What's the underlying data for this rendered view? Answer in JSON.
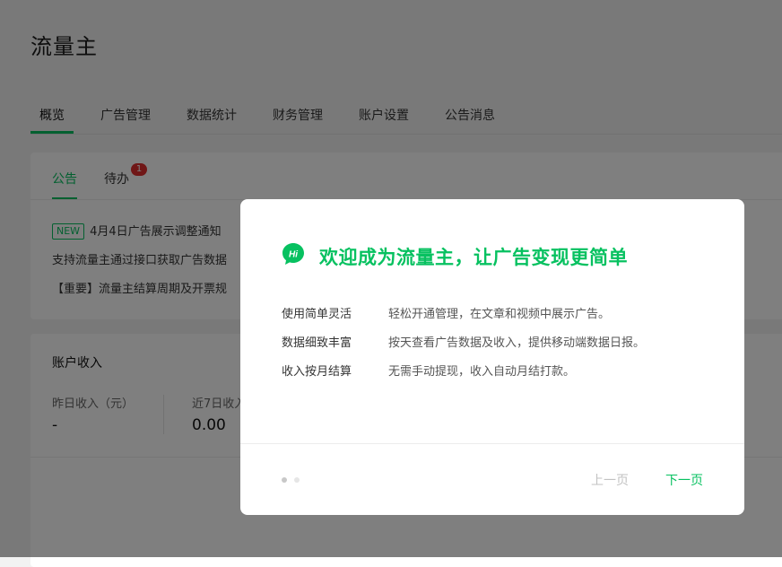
{
  "app": {
    "title": "流量主"
  },
  "main_tabs": [
    {
      "label": "概览"
    },
    {
      "label": "广告管理"
    },
    {
      "label": "数据统计"
    },
    {
      "label": "财务管理"
    },
    {
      "label": "账户设置"
    },
    {
      "label": "公告消息"
    }
  ],
  "notice_card": {
    "tabs": [
      {
        "label": "公告"
      },
      {
        "label": "待办"
      }
    ],
    "todo_badge": "1",
    "new_tag": "NEW",
    "items": [
      "4月4日广告展示调整通知",
      "支持流量主通过接口获取广告数据",
      "【重要】流量主结算周期及开票规"
    ]
  },
  "income_card": {
    "title": "账户收入",
    "stats": [
      {
        "label": "昨日收入（元）",
        "value": "-"
      },
      {
        "label": "近7日收入",
        "value": "0.00"
      }
    ]
  },
  "modal": {
    "icon": "hi-chat-bubble-icon",
    "icon_text": "Hi",
    "title": "欢迎成为流量主，让广告变现更简单",
    "features": [
      {
        "name": "使用简单灵活",
        "desc": "轻松开通管理，在文章和视频中展示广告。"
      },
      {
        "name": "数据细致丰富",
        "desc": "按天查看广告数据及收入，提供移动端数据日报。"
      },
      {
        "name": "收入按月结算",
        "desc": "无需手动提现，收入自动月结打款。"
      }
    ],
    "prev_label": "上一页",
    "next_label": "下一页"
  },
  "colors": {
    "accent": "#07c160",
    "badge": "#e02e2e",
    "mask": "rgba(0,0,0,0.5)"
  }
}
